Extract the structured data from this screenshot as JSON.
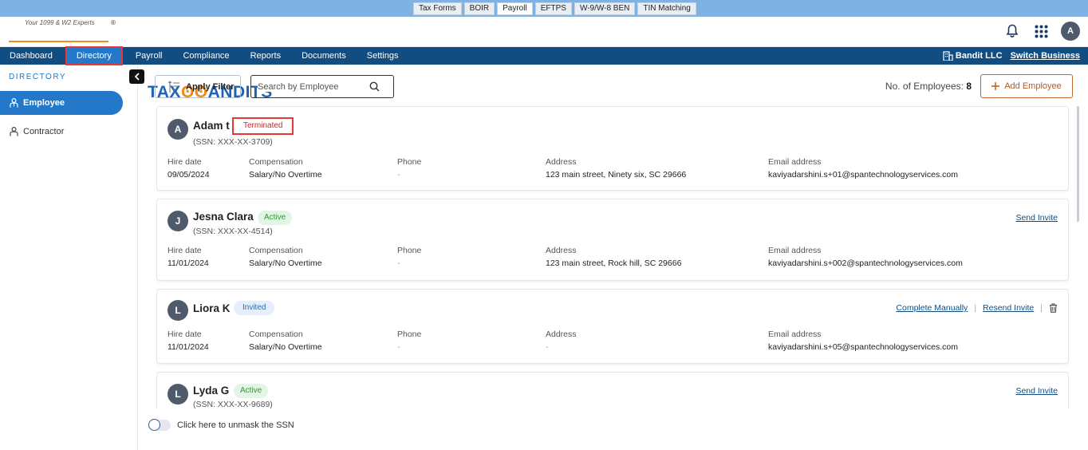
{
  "product_tabs": [
    {
      "label": "Tax Forms",
      "active": false
    },
    {
      "label": "BOIR",
      "active": false
    },
    {
      "label": "Payroll",
      "active": true
    },
    {
      "label": "EFTPS",
      "active": false
    },
    {
      "label": "W-9/W-8 BEN",
      "active": false
    },
    {
      "label": "TIN Matching",
      "active": false
    }
  ],
  "logo": {
    "text_left": "TAX",
    "text_right": "ANDITS",
    "tagline": "Your 1099 & W2 Experts",
    "reg": "®"
  },
  "header": {
    "avatar_initial": "A",
    "icons": [
      "bell-icon",
      "apps-grid-icon"
    ]
  },
  "nav": {
    "items": [
      "Dashboard",
      "Directory",
      "Payroll",
      "Compliance",
      "Reports",
      "Documents",
      "Settings"
    ],
    "active": "Directory",
    "business_name": "Bandit LLC",
    "switch_label": "Switch Business"
  },
  "sidebar": {
    "title": "DIRECTORY",
    "items": [
      {
        "label": "Employee",
        "icon": "employee-icon",
        "active": true
      },
      {
        "label": "Contractor",
        "icon": "contractor-icon",
        "active": false
      }
    ]
  },
  "toolbar": {
    "filter_label": "Apply Filter",
    "search_placeholder": "Search by Employee",
    "count_label": "No. of Employees:",
    "count_value": "8",
    "add_label": "Add Employee"
  },
  "field_labels": {
    "hire": "Hire date",
    "comp": "Compensation",
    "phone": "Phone",
    "address": "Address",
    "email": "Email address"
  },
  "employees": [
    {
      "initial": "A",
      "name": "Adam t",
      "status": "Terminated",
      "ssn": "(SSN: XXX-XX-3709)",
      "hire_date": "09/05/2024",
      "compensation": "Salary/No Overtime",
      "phone": "-",
      "address": "123 main street, Ninety six, SC 29666",
      "email": "kaviyadarshini.s+01@spantechnologyservices.com",
      "actions": []
    },
    {
      "initial": "J",
      "name": "Jesna Clara",
      "status": "Active",
      "ssn": "(SSN: XXX-XX-4514)",
      "hire_date": "11/01/2024",
      "compensation": "Salary/No Overtime",
      "phone": "-",
      "address": "123 main street, Rock hill, SC 29666",
      "email": "kaviyadarshini.s+002@spantechnologyservices.com",
      "actions": [
        "Send Invite"
      ]
    },
    {
      "initial": "L",
      "name": "Liora K",
      "status": "Invited",
      "ssn": "",
      "hire_date": "11/01/2024",
      "compensation": "Salary/No Overtime",
      "phone": "-",
      "address": "-",
      "email": "kaviyadarshini.s+05@spantechnologyservices.com",
      "actions": [
        "Complete Manually",
        "Resend Invite"
      ]
    },
    {
      "initial": "L",
      "name": "Lyda G",
      "status": "Active",
      "ssn": "(SSN: XXX-XX-9689)",
      "hire_date": "",
      "compensation": "",
      "phone": "",
      "address": "",
      "email": "",
      "actions": [
        "Send Invite"
      ]
    }
  ],
  "unmask_label": "Click here to unmask the SSN",
  "colors": {
    "nav": "#124d82",
    "accent": "#2378c9",
    "orange": "#f08a1d",
    "terminated": "#c62828",
    "active": "#2e9a3a"
  }
}
